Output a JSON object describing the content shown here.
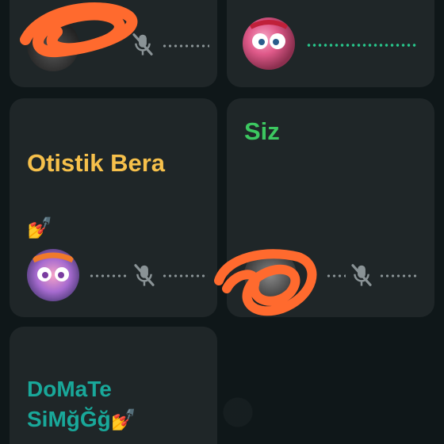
{
  "participants": [
    {
      "name": "",
      "muted": true,
      "speaking": false
    },
    {
      "name": "",
      "muted": false,
      "speaking": true
    },
    {
      "name": "Otistik Bera",
      "emoji": "💅",
      "muted": true,
      "speaking": false
    },
    {
      "name": "Siz",
      "muted": true,
      "speaking": false
    },
    {
      "name": "DoMaTe\nSiMğĞğ",
      "emoji": "💅",
      "muted": false,
      "speaking": false
    }
  ],
  "colors": {
    "name_otistik": "#f6c04b",
    "name_siz": "#3cc760",
    "name_domate": "#19a89a",
    "tile_bg": "#1f2628",
    "muted_icon": "#8a9396",
    "speaking_dots": "#27c48a",
    "redaction_scribble": "#ff6a2e"
  },
  "icons": {
    "muted": "mic-off-icon",
    "avatar": "avatar"
  }
}
